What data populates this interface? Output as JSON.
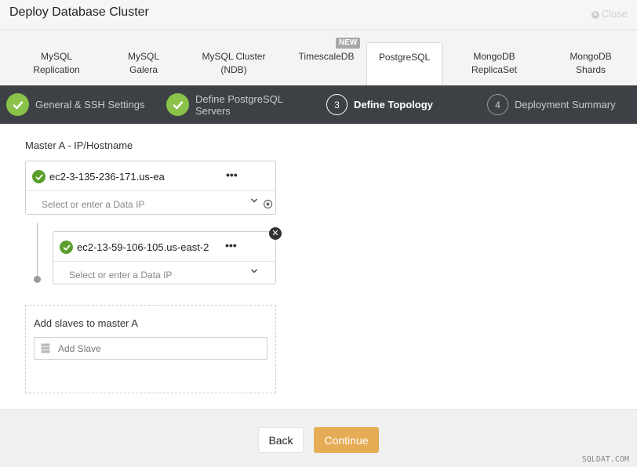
{
  "window": {
    "title": "Deploy Database Cluster",
    "close_label": "Close"
  },
  "tabs": [
    {
      "label_line1": "MySQL",
      "label_line2": "Replication"
    },
    {
      "label_line1": "MySQL",
      "label_line2": "Galera"
    },
    {
      "label_line1": "MySQL Cluster",
      "label_line2": "(NDB)"
    },
    {
      "label_line1": "TimescaleDB",
      "label_line2": "",
      "badge": "NEW"
    },
    {
      "label_line1": "PostgreSQL",
      "label_line2": "",
      "active": true
    },
    {
      "label_line1": "MongoDB",
      "label_line2": "ReplicaSet"
    },
    {
      "label_line1": "MongoDB",
      "label_line2": "Shards"
    }
  ],
  "steps": [
    {
      "state": "done",
      "label_line1": "General & SSH Settings",
      "label_line2": ""
    },
    {
      "state": "done",
      "label_line1": "Define PostgreSQL",
      "label_line2": "Servers"
    },
    {
      "state": "current",
      "number": "3",
      "label_line1": "Define Topology"
    },
    {
      "state": "pending",
      "number": "4",
      "label_line1": "Deployment Summary"
    }
  ],
  "topology": {
    "master_label": "Master A - IP/Hostname",
    "master": {
      "host": "ec2-3-135-236-171.us-ea",
      "data_ip_placeholder": "Select or enter a Data IP"
    },
    "slave": {
      "host": "ec2-13-59-106-105.us-east-2",
      "data_ip_placeholder": "Select or enter a Data IP"
    },
    "add_slaves_title": "Add slaves to master A",
    "add_slave_placeholder": "Add Slave"
  },
  "footer": {
    "back_label": "Back",
    "continue_label": "Continue"
  },
  "watermark": "SQLDAT.COM",
  "colors": {
    "accent": "#e6ac55",
    "success": "#8bc34a",
    "steps_bg": "#3d4146"
  },
  "icons": [
    "close-icon",
    "check-icon",
    "more-icon",
    "chevron-down-icon",
    "locate-icon",
    "remove-icon",
    "server-icon"
  ]
}
